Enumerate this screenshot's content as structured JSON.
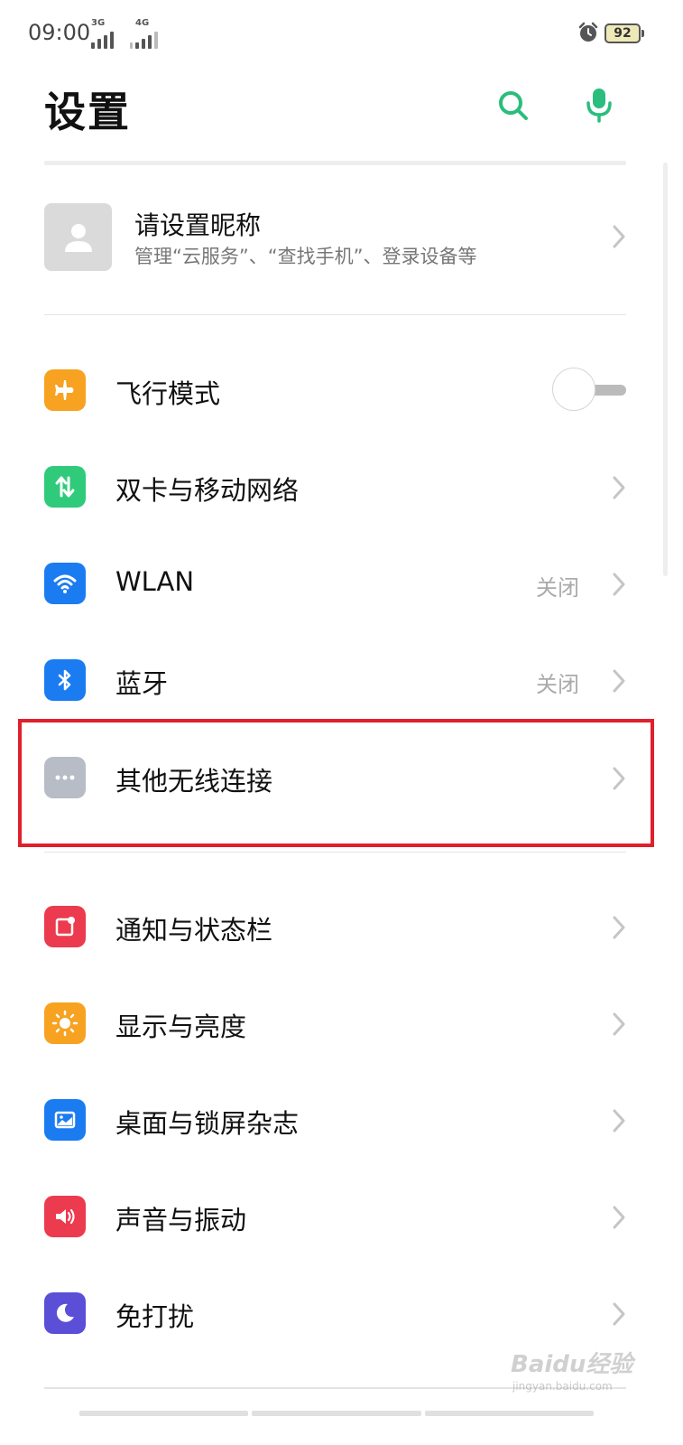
{
  "status_bar": {
    "time": "09:00",
    "net1": "3G",
    "net2": "4G",
    "battery": "92"
  },
  "header": {
    "title": "设置",
    "search_icon": "search-icon",
    "mic_icon": "microphone-icon",
    "accent": "#2bbd7e"
  },
  "profile": {
    "name": "请设置昵称",
    "subtitle": "管理“云服务”、“查找手机”、登录设备等"
  },
  "settings": {
    "airplane": {
      "label": "飞行模式",
      "icon": "airplane-icon",
      "color": "#f7a221",
      "enabled": false
    },
    "dual_sim": {
      "label": "双卡与移动网络",
      "icon": "data-arrows-icon",
      "color": "#2fca7a"
    },
    "wlan": {
      "label": "WLAN",
      "value": "关闭",
      "icon": "wifi-icon",
      "color": "#1b7cf2"
    },
    "bluetooth": {
      "label": "蓝牙",
      "value": "关闭",
      "icon": "bluetooth-icon",
      "color": "#1b7cf2"
    },
    "other_wireless": {
      "label": "其他无线连接",
      "icon": "more-dots-icon",
      "color": "#b8bcc6"
    },
    "notification": {
      "label": "通知与状态栏",
      "icon": "notification-icon",
      "color": "#ec3a4e"
    },
    "display": {
      "label": "显示与亮度",
      "icon": "brightness-icon",
      "color": "#f7a221"
    },
    "wallpaper": {
      "label": "桌面与锁屏杂志",
      "icon": "wallpaper-icon",
      "color": "#1b7cf2"
    },
    "sound": {
      "label": "声音与振动",
      "icon": "speaker-icon",
      "color": "#ec3a4e"
    },
    "dnd": {
      "label": "免打扰",
      "icon": "moon-icon",
      "color": "#5a4fd6"
    }
  },
  "watermark": {
    "text": "Baidu经验",
    "url": "jingyan.baidu.com"
  }
}
